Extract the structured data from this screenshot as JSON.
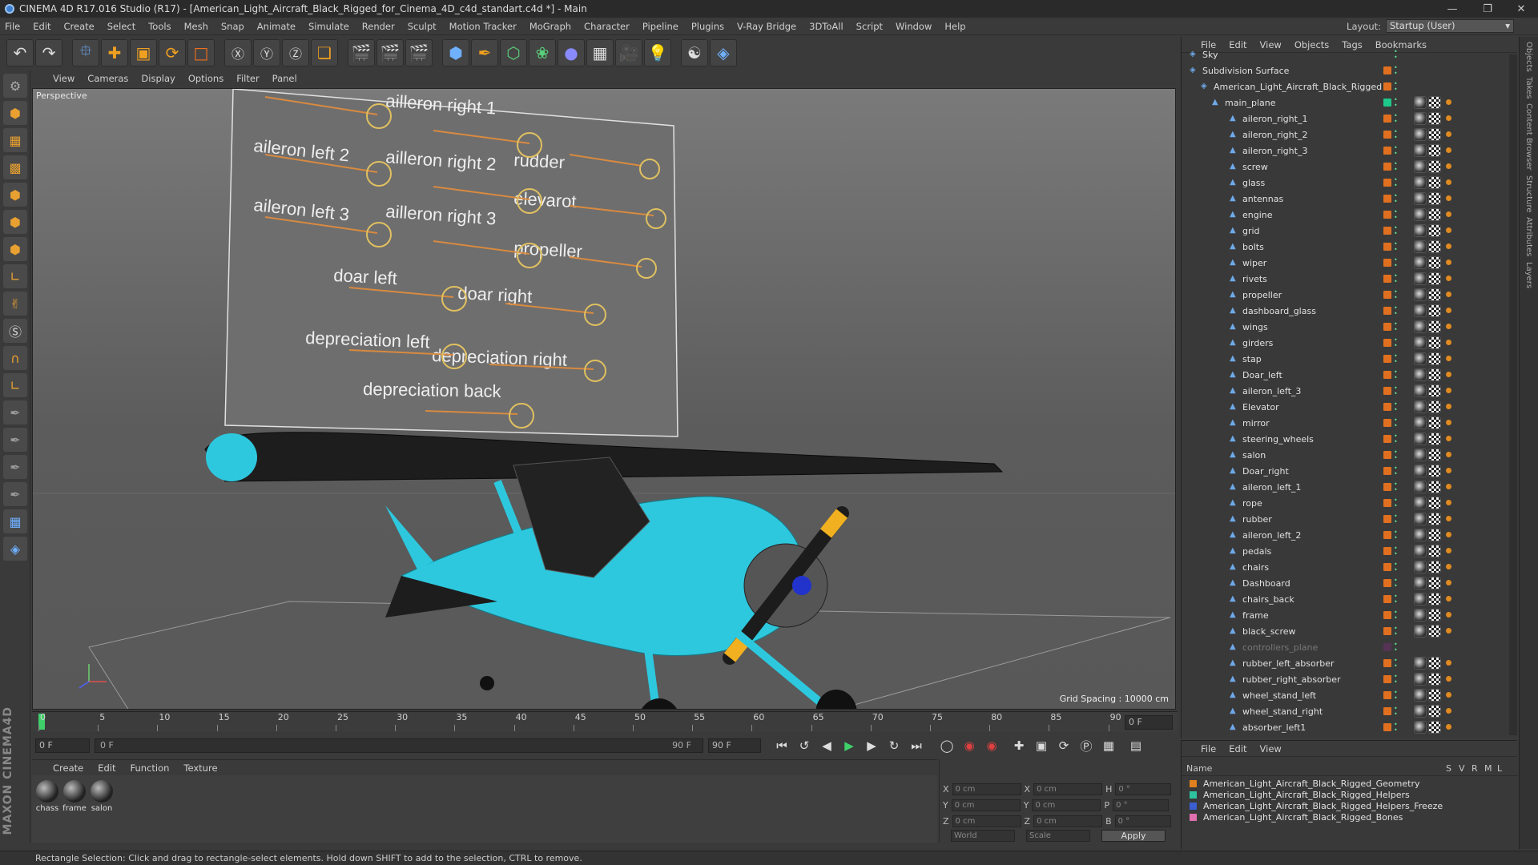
{
  "title": "CINEMA 4D R17.016 Studio (R17) - [American_Light_Aircraft_Black_Rigged_for_Cinema_4D_c4d_standart.c4d *] - Main",
  "menus": [
    "File",
    "Edit",
    "Create",
    "Select",
    "Tools",
    "Mesh",
    "Snap",
    "Animate",
    "Simulate",
    "Render",
    "Sculpt",
    "Motion Tracker",
    "MoGraph",
    "Character",
    "Pipeline",
    "Plugins",
    "V-Ray Bridge",
    "3DToAll",
    "Script",
    "Window",
    "Help"
  ],
  "layout": {
    "label": "Layout:",
    "value": "Startup (User)"
  },
  "viewport": {
    "menus": [
      "View",
      "Cameras",
      "Display",
      "Options",
      "Filter",
      "Panel"
    ],
    "label": "Perspective",
    "grid_spacing": "Grid Spacing : 10000 cm",
    "controller_labels": [
      "ailleron right 1",
      "rudder",
      "aileron left 2",
      "ailleron right 2",
      "elevarot",
      "aileron left 3",
      "ailleron right 3",
      "propeller",
      "doar left",
      "doar right",
      "depreciation left",
      "depreciation right",
      "depreciation back"
    ]
  },
  "timeline": {
    "ticks": [
      "0",
      "5",
      "10",
      "15",
      "20",
      "25",
      "30",
      "35",
      "40",
      "45",
      "50",
      "55",
      "60",
      "65",
      "70",
      "75",
      "80",
      "85",
      "90"
    ],
    "current": "0 F",
    "start": "0 F",
    "range_start": "0 F",
    "range_end": "90 F",
    "end": "90 F"
  },
  "materials": {
    "menus": [
      "Create",
      "Edit",
      "Function",
      "Texture"
    ],
    "items": [
      "chass",
      "frame",
      "salon"
    ]
  },
  "coords": {
    "x1": "0 cm",
    "y1": "0 cm",
    "z1": "0 cm",
    "x2": "0 cm",
    "y2": "0 cm",
    "z2": "0 cm",
    "h": "0 °",
    "p": "0 °",
    "b": "0 °",
    "world": "World",
    "scale": "Scale",
    "apply": "Apply"
  },
  "status": "Rectangle Selection: Click and drag to rectangle-select elements. Hold down SHIFT to add to the selection, CTRL to remove.",
  "objects": {
    "menus": [
      "File",
      "Edit",
      "View",
      "Objects",
      "Tags",
      "Bookmarks"
    ],
    "rows": [
      {
        "name": "Sky",
        "indent": 0
      },
      {
        "name": "Subdivision Surface",
        "indent": 0
      },
      {
        "name": "American_Light_Aircraft_Black_Rigged",
        "indent": 1
      },
      {
        "name": "main_plane",
        "indent": 2
      },
      {
        "name": "aileron_right_1",
        "indent": 3
      },
      {
        "name": "aileron_right_2",
        "indent": 3
      },
      {
        "name": "aileron_right_3",
        "indent": 3
      },
      {
        "name": "screw",
        "indent": 3
      },
      {
        "name": "glass",
        "indent": 3
      },
      {
        "name": "antennas",
        "indent": 3
      },
      {
        "name": "engine",
        "indent": 3
      },
      {
        "name": "grid",
        "indent": 3
      },
      {
        "name": "bolts",
        "indent": 3
      },
      {
        "name": "wiper",
        "indent": 3
      },
      {
        "name": "rivets",
        "indent": 3
      },
      {
        "name": "propeller",
        "indent": 3
      },
      {
        "name": "dashboard_glass",
        "indent": 3
      },
      {
        "name": "wings",
        "indent": 3
      },
      {
        "name": "girders",
        "indent": 3
      },
      {
        "name": "stap",
        "indent": 3
      },
      {
        "name": "Doar_left",
        "indent": 3
      },
      {
        "name": "aileron_left_3",
        "indent": 3
      },
      {
        "name": "Elevator",
        "indent": 3
      },
      {
        "name": "mirror",
        "indent": 3
      },
      {
        "name": "steering_wheels",
        "indent": 3
      },
      {
        "name": "salon",
        "indent": 3
      },
      {
        "name": "Doar_right",
        "indent": 3
      },
      {
        "name": "aileron_left_1",
        "indent": 3
      },
      {
        "name": "rope",
        "indent": 3
      },
      {
        "name": "rubber",
        "indent": 3
      },
      {
        "name": "aileron_left_2",
        "indent": 3
      },
      {
        "name": "pedals",
        "indent": 3
      },
      {
        "name": "chairs",
        "indent": 3
      },
      {
        "name": "Dashboard",
        "indent": 3
      },
      {
        "name": "chairs_back",
        "indent": 3
      },
      {
        "name": "frame",
        "indent": 3
      },
      {
        "name": "black_screw",
        "indent": 3
      },
      {
        "name": "controllers_plane",
        "indent": 3
      },
      {
        "name": "rubber_left_absorber",
        "indent": 3
      },
      {
        "name": "rubber_right_absorber",
        "indent": 3
      },
      {
        "name": "wheel_stand_left",
        "indent": 3
      },
      {
        "name": "wheel_stand_right",
        "indent": 3
      },
      {
        "name": "absorber_left1",
        "indent": 3
      }
    ]
  },
  "layers": {
    "menus": [
      "File",
      "Edit",
      "View"
    ],
    "header": {
      "name": "Name",
      "cols": [
        "S",
        "V",
        "R",
        "M",
        "L"
      ]
    },
    "rows": [
      {
        "name": "American_Light_Aircraft_Black_Rigged_Geometry",
        "color": "#e0801e"
      },
      {
        "name": "American_Light_Aircraft_Black_Rigged_Helpers",
        "color": "#2ec4a0"
      },
      {
        "name": "American_Light_Aircraft_Black_Rigged_Helpers_Freeze",
        "color": "#3a5fd0"
      },
      {
        "name": "American_Light_Aircraft_Black_Rigged_Bones",
        "color": "#e070b0"
      }
    ]
  },
  "side_tabs": [
    "Objects",
    "Takes",
    "Content Browser",
    "Structure",
    "Attributes",
    "Layers"
  ],
  "colors": {
    "accent": "#e07020",
    "plane_cyan": "#2ec8de",
    "plane_black": "#1c1c1c"
  }
}
